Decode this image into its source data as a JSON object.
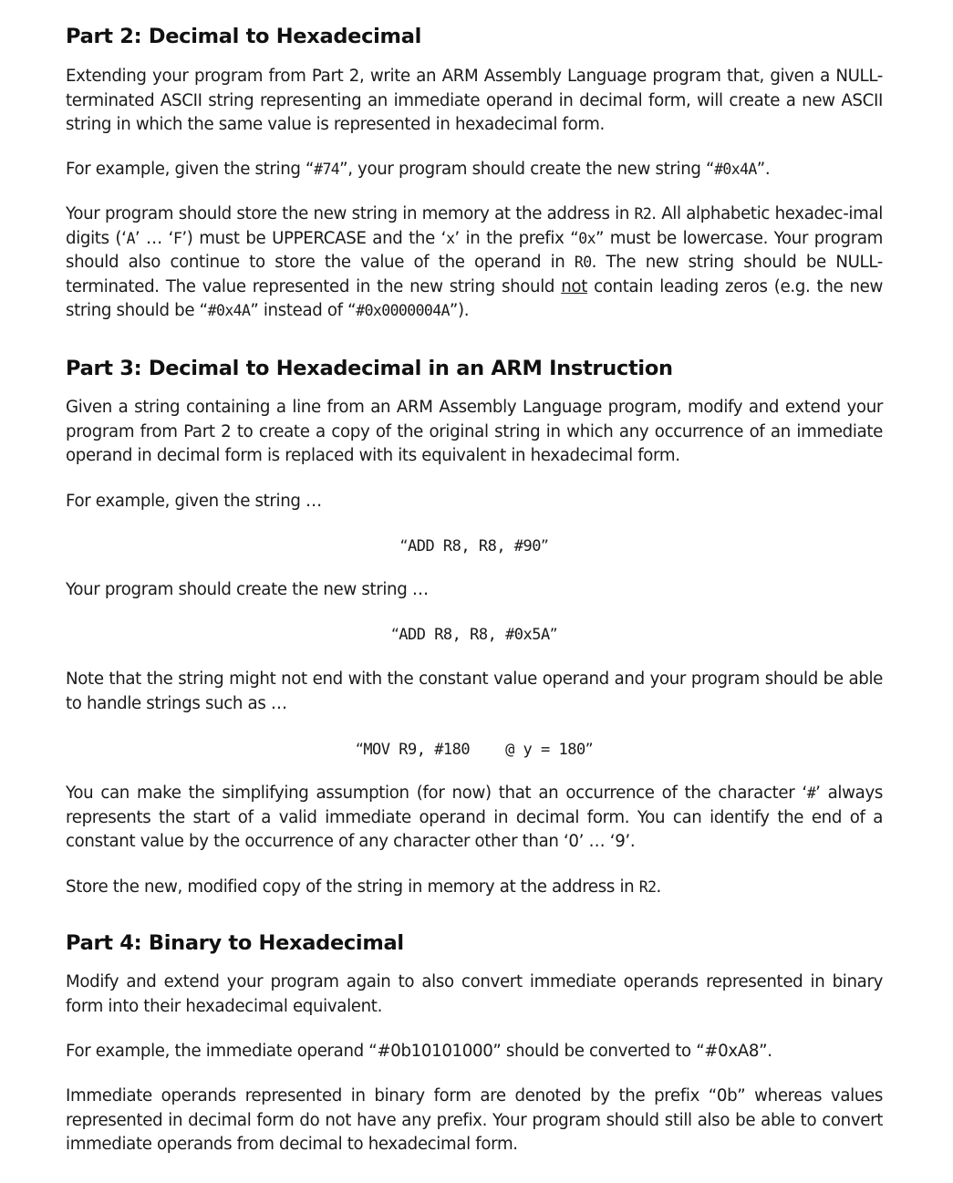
{
  "parts": {
    "part2": {
      "heading": "Part 2: Decimal to Hexadecimal",
      "para1": [
        {
          "t": "Extending your program from Part 2, write an ARM Assembly Language program that, given a NULL-terminated ASCII string representing an immediate operand in decimal form, will create a new ASCII string in which the same value is represented in hexadecimal form."
        }
      ],
      "para2": [
        {
          "t": "For example, given the string “"
        },
        {
          "t": "#74",
          "s": "tt"
        },
        {
          "t": "”, your program should create the new string “"
        },
        {
          "t": "#0x4A",
          "s": "tt"
        },
        {
          "t": "”."
        }
      ],
      "para3": [
        {
          "t": "Your program should store the new string in memory at the address in "
        },
        {
          "t": "R2",
          "s": "tt"
        },
        {
          "t": ". All alphabetic hexadec-imal digits (‘"
        },
        {
          "t": "A",
          "s": "tt"
        },
        {
          "t": "’ … ‘"
        },
        {
          "t": "F",
          "s": "tt"
        },
        {
          "t": "’) must be UPPERCASE and the ‘"
        },
        {
          "t": "x",
          "s": "tt"
        },
        {
          "t": "’ in the prefix “"
        },
        {
          "t": "0x",
          "s": "tt"
        },
        {
          "t": "” must be lowercase. Your program should also continue to store the value of the operand in "
        },
        {
          "t": "R0",
          "s": "tt"
        },
        {
          "t": ". The new string should be NULL-terminated. The value represented in the new string should "
        },
        {
          "t": "not",
          "s": "u"
        },
        {
          "t": " contain leading zeros (e.g. the new string should be “"
        },
        {
          "t": "#0x4A",
          "s": "tt"
        },
        {
          "t": "” instead of “"
        },
        {
          "t": "#0x0000004A",
          "s": "tt"
        },
        {
          "t": "”)."
        }
      ]
    },
    "part3": {
      "heading": "Part 3: Decimal to Hexadecimal in an ARM Instruction",
      "para1": [
        {
          "t": "Given a string containing a line from an ARM Assembly Language program, modify and extend your program from Part 2 to create a copy of the original string in which any occurrence of an immediate operand in decimal form is replaced with its equivalent in hexadecimal form."
        }
      ],
      "para2": [
        {
          "t": "For example, given the string …"
        }
      ],
      "code1": "ADD R8, R8, #90",
      "para3": [
        {
          "t": "Your program should create the new string …"
        }
      ],
      "code2": "ADD R8, R8, #0x5A",
      "para4": [
        {
          "t": "Note that the string might not end with the constant value operand and your program should be able to handle strings such as …"
        }
      ],
      "code3": "MOV R9, #180    @ y = 180",
      "para5": [
        {
          "t": "You can make the simplifying assumption (for now) that an occurrence of the character ‘"
        },
        {
          "t": "#",
          "s": "tt"
        },
        {
          "t": "’ always represents the start of a valid immediate operand in decimal form. You can identify the end of a constant value by the occurrence of any character other than ‘0’ … ‘9’."
        }
      ],
      "para6": [
        {
          "t": "Store the new, modified copy of the string in memory at the address in "
        },
        {
          "t": "R2",
          "s": "tt"
        },
        {
          "t": "."
        }
      ]
    },
    "part4": {
      "heading": "Part 4: Binary to Hexadecimal",
      "para1": [
        {
          "t": "Modify and extend your program again to also convert immediate operands represented in binary form into their hexadecimal equivalent."
        }
      ],
      "para2": [
        {
          "t": "For example, the immediate operand “#0b10101000” should be converted to “#0xA8”."
        }
      ],
      "para3": [
        {
          "t": "Immediate operands represented in binary form are denoted by the prefix “0b” whereas values represented in decimal form do not have any prefix. Your program should still also be able to convert immediate operands from decimal to hexadecimal form."
        }
      ]
    }
  }
}
